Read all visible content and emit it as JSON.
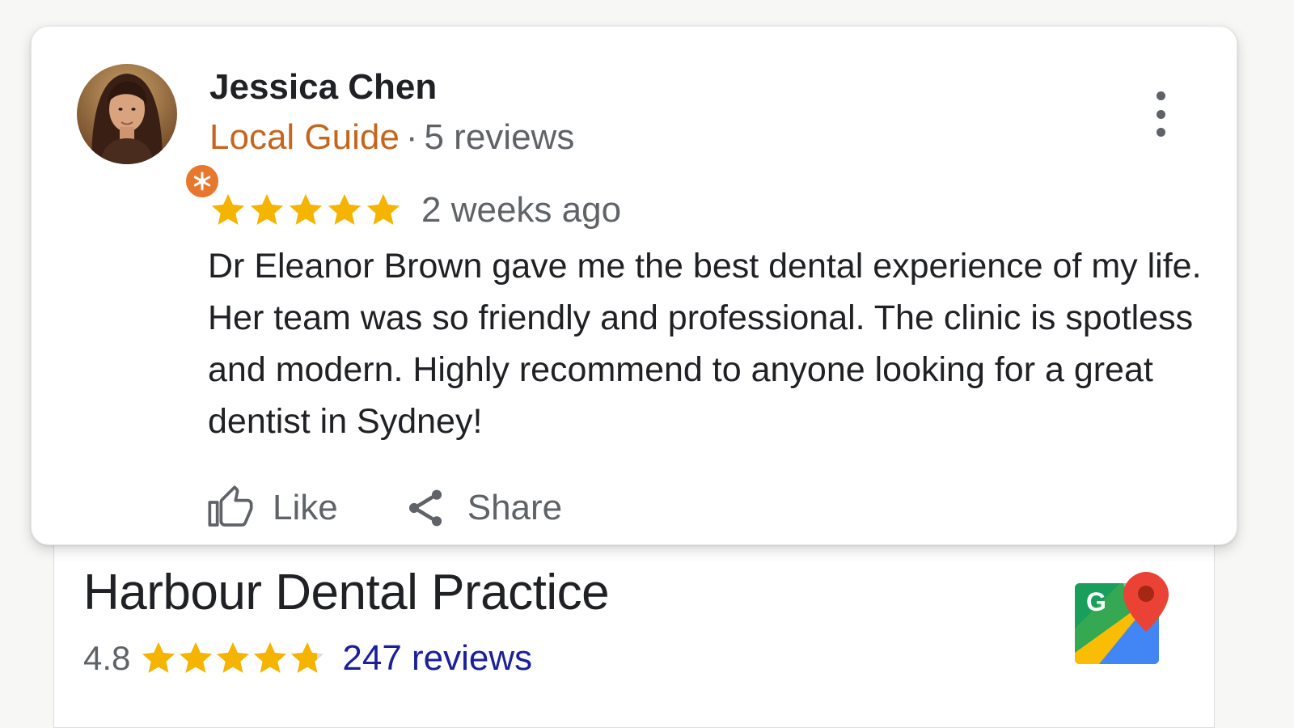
{
  "review": {
    "reviewer": {
      "name": "Jessica Chen",
      "badge": "Local Guide",
      "separator": "·",
      "review_count": "5 reviews",
      "avatar_icon": "reviewer-avatar",
      "badge_icon": "local-guide-star-icon"
    },
    "rating": 5,
    "rating_max": 5,
    "date": "2 weeks ago",
    "text": "Dr Eleanor Brown gave me the best dental experience of my life. Her team was so friendly and professional. The clinic is spotless and modern. Highly recommend  to anyone looking for a great dentist in Sydney!",
    "actions": {
      "like_label": "Like",
      "share_label": "Share",
      "like_icon": "thumbs-up-icon",
      "share_icon": "share-icon"
    },
    "menu_icon": "more-vert-icon"
  },
  "place": {
    "name": "Harbour Dental Practice",
    "rating_text": "4.8",
    "rating_value": 4.8,
    "rating_max": 5,
    "reviews_link": "247 reviews",
    "logo_icon": "google-maps-logo"
  },
  "colors": {
    "star": "#f5b400",
    "star_empty": "#dadce0",
    "local_guide": "#c5661d",
    "link": "#1a1f9c",
    "text": "#202124",
    "secondary_text": "#5f6368"
  }
}
